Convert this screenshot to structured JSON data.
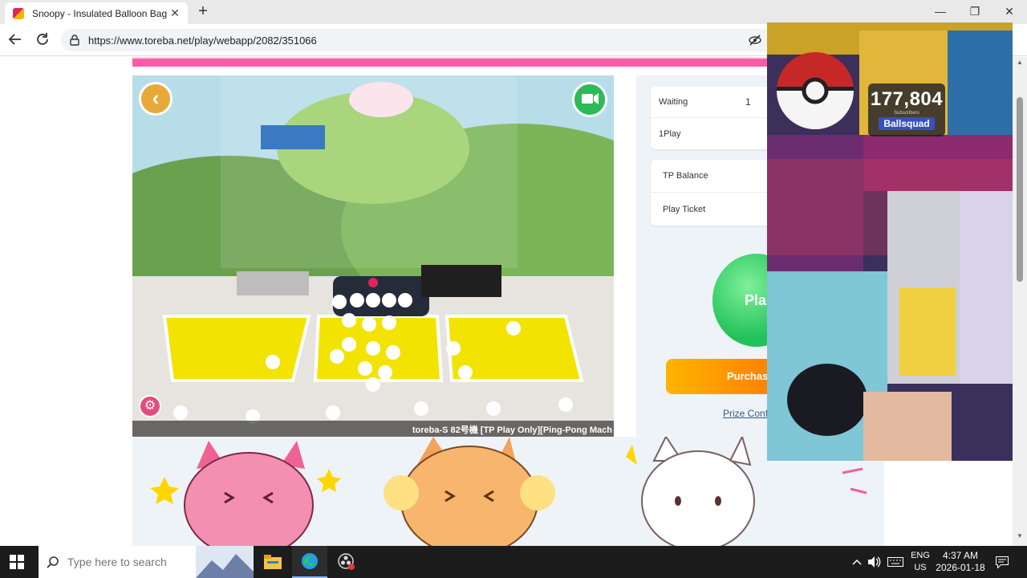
{
  "browser": {
    "tab_title": "Snoopy - Insulated Balloon Bag S",
    "tab_close": "✕",
    "new_tab": "+",
    "url": "https://www.toreba.net/play/webapp/2082/351066",
    "window_controls": {
      "minimize": "—",
      "maximize": "❐",
      "close": "✕"
    }
  },
  "game": {
    "stream_caption": "toreba-S 82号機 [TP Play Only][Ping-Pong Mach",
    "back_glyph": "‹",
    "settings_glyph": "⚙",
    "queue": [
      {
        "label": "Waiting",
        "value": "1"
      },
      {
        "label": "1Play",
        "value": ""
      }
    ],
    "balance": [
      {
        "label": "TP Balance",
        "value": ""
      },
      {
        "label": "Play Ticket",
        "value": ""
      }
    ],
    "play_label": "Pla",
    "purchase_label": "Purchas",
    "prize_link": "Prize Confi"
  },
  "overlay": {
    "subscriber_count": "177,804",
    "subscriber_label": "Subscribers",
    "channel_name": "Ballsquad"
  },
  "taskbar": {
    "search_placeholder": "Type here to search",
    "lang_line1": "ENG",
    "lang_line2": "US",
    "time": "4:37 AM",
    "date": "2026-01-18"
  },
  "colors": {
    "accent_pink": "#ff5aa8",
    "play_green": "#22c25a",
    "purchase_orange": "#ff9a00",
    "back_orange": "#e6a93a"
  },
  "icons": [
    "back-arrow-icon",
    "reload-icon",
    "lock-icon",
    "eye-off-icon",
    "camera-switch-icon",
    "settings-icon",
    "windows-icon",
    "search-icon",
    "file-explorer-icon",
    "edge-icon",
    "obs-icon",
    "chevron-up-icon",
    "volume-icon",
    "keyboard-icon",
    "notification-icon"
  ]
}
